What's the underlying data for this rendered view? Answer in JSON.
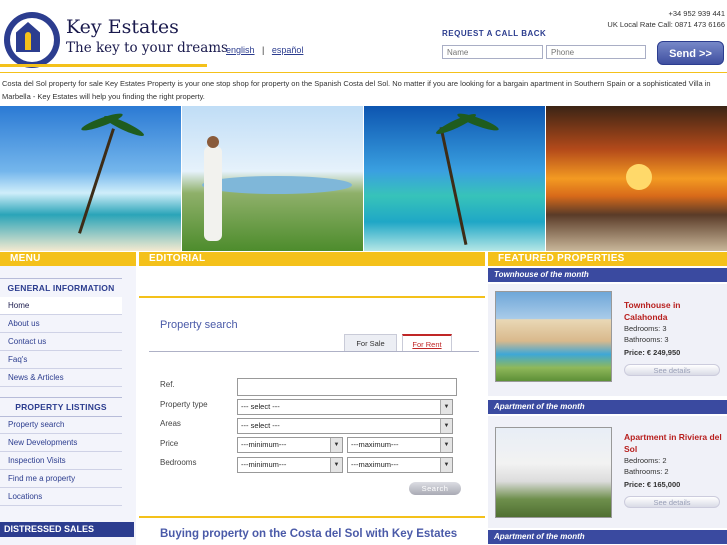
{
  "brand": {
    "name": "Key Estates",
    "tagline": "The key to your dreams"
  },
  "languages": {
    "english": "english",
    "separator": "|",
    "spanish": "español"
  },
  "contact": {
    "phone_main": "+34 952 939 441",
    "phone_uk": "UK Local Rate Call: 0871 473 6166"
  },
  "callback": {
    "title": "REQUEST A CALL BACK",
    "name_placeholder": "Name",
    "phone_placeholder": "Phone",
    "send_label": "Send >>"
  },
  "intro": "Costa del Sol property for sale Key Estates Property is your one stop shop for property on the Spanish Costa del Sol. No matter if you are looking for a bargain apartment in Southern Spain or a sophisticated Villa in Marbella - Key Estates will help you finding the right property.",
  "columns": {
    "menu": "MENU",
    "editorial": "EDITORIAL",
    "featured": "FEATURED PROPERTIES"
  },
  "menu": {
    "general_title": "GENERAL INFORMATION",
    "general_items": [
      "Home",
      "About us",
      "Contact us",
      "Faq's",
      "News & Articles"
    ],
    "listings_title": "PROPERTY LISTINGS",
    "listing_items": [
      "Property search",
      "New Developments",
      "Inspection Visits",
      "Find me a property",
      "Locations"
    ],
    "distressed": "DISTRESSED SALES"
  },
  "search": {
    "title": "Property search",
    "tab_sale": "For Sale",
    "tab_rent": "For Rent",
    "labels": {
      "ref": "Ref.",
      "type": "Property type",
      "areas": "Areas",
      "price": "Price",
      "bedrooms": "Bedrooms"
    },
    "type_value": "--- select ---",
    "areas_value": "--- select ---",
    "price_min": "---minimum---",
    "price_max": "---maximum---",
    "bed_min": "---minimum---",
    "bed_max": "---maximum---",
    "button": "Search"
  },
  "editorial_heading": "Buying property on the Costa del Sol with Key Estates",
  "featured": [
    {
      "section": "Townhouse of the month",
      "title": "Townhouse in Calahonda",
      "bedrooms": "Bedrooms: 3",
      "bathrooms": "Bathrooms: 3",
      "price": "Price: € 249,950",
      "see": "See details"
    },
    {
      "section": "Apartment of the month",
      "title": "Apartment in Riviera del Sol",
      "bedrooms": "Bedrooms: 2",
      "bathrooms": "Bathrooms: 2",
      "price": "Price: € 165,000",
      "see": "See details"
    }
  ],
  "featured_next_section": "Apartment of the month",
  "colors": {
    "accent": "#f4c11a",
    "brand": "#2c3d8f",
    "highlight": "#b8201f"
  }
}
